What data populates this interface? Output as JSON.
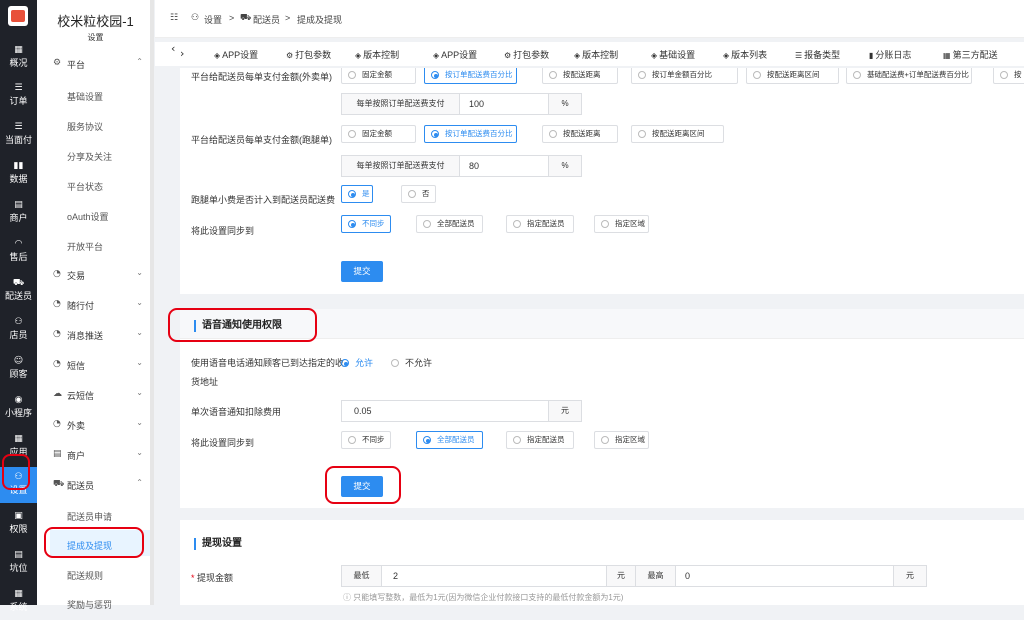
{
  "left_nav": [
    {
      "icon": "▦",
      "label": "概况"
    },
    {
      "icon": "☰",
      "label": "订单"
    },
    {
      "icon": "☰",
      "label": "当面付"
    },
    {
      "icon": "▮▮",
      "label": "数据"
    },
    {
      "icon": "▤",
      "label": "商户"
    },
    {
      "icon": "◠",
      "label": "售后"
    },
    {
      "icon": "⛟",
      "label": "配送员"
    },
    {
      "icon": "⚇",
      "label": "店员"
    },
    {
      "icon": "☺",
      "label": "顾客"
    },
    {
      "icon": "◉",
      "label": "小程序"
    },
    {
      "icon": "▦",
      "label": "应用"
    },
    {
      "icon": "⚇",
      "label": "设置"
    },
    {
      "icon": "▣",
      "label": "权限"
    },
    {
      "icon": "▤",
      "label": "坑位"
    },
    {
      "icon": "▦",
      "label": "系统"
    }
  ],
  "sidebar": {
    "school_name": "校米粒校园-1",
    "subtitle": "设置",
    "platform": {
      "icon": "⚙",
      "label": "平台",
      "arrow": "⌃"
    },
    "platform_items": [
      "基础设置",
      "服务协议",
      "分享及关注",
      "平台状态",
      "oAuth设置",
      "开放平台"
    ],
    "groups": [
      {
        "icon": "◔",
        "label": "交易",
        "arrow": "⌄"
      },
      {
        "icon": "◔",
        "label": "随行付",
        "arrow": "⌄"
      },
      {
        "icon": "◔",
        "label": "消息推送",
        "arrow": "⌄"
      },
      {
        "icon": "◔",
        "label": "短信",
        "arrow": "⌄"
      },
      {
        "icon": "☁",
        "label": "云短信",
        "arrow": "⌄"
      },
      {
        "icon": "◔",
        "label": "外卖",
        "arrow": "⌄"
      },
      {
        "icon": "▤",
        "label": "商户",
        "arrow": "⌄"
      },
      {
        "icon": "⛟",
        "label": "配送员",
        "arrow": "⌃"
      }
    ],
    "courier_items": [
      "配送员申请",
      "提成及提现",
      "配送规则",
      "奖励与惩罚"
    ]
  },
  "topbar": {
    "menu_icon": "☷",
    "crumb_icon": "⚇",
    "crumb1": "设置",
    "sep": ">",
    "crumb2_icon": "⛟",
    "crumb2": "配送员",
    "crumb3": "提成及提现"
  },
  "tabs": {
    "prev": "‹",
    "next": "›",
    "items": [
      {
        "icon": "◈",
        "label": "APP设置"
      },
      {
        "icon": "⚙",
        "label": "打包参数"
      },
      {
        "icon": "◈",
        "label": "版本控制"
      },
      {
        "icon": "◈",
        "label": "APP设置"
      },
      {
        "icon": "⚙",
        "label": "打包参数"
      },
      {
        "icon": "◈",
        "label": "版本控制"
      },
      {
        "icon": "◈",
        "label": "基础设置"
      },
      {
        "icon": "◈",
        "label": "版本列表"
      },
      {
        "icon": "☰",
        "label": "报备类型"
      },
      {
        "icon": "▮",
        "label": "分账日志"
      },
      {
        "icon": "▦",
        "label": "第三方配送"
      }
    ]
  },
  "pay_takeout": {
    "label": "平台给配送员每单支付金额(外卖单)",
    "options": [
      "固定金额",
      "按订单配送费百分比",
      "按配送距离",
      "按订单金额百分比",
      "按配送距离区间",
      "基础配送费+订单配送费百分比",
      "按"
    ],
    "input_prefix": "每单按照订单配送费支付",
    "input_value": "100",
    "input_suffix": "%"
  },
  "pay_errand": {
    "label": "平台给配送员每单支付金额(跑腿单)",
    "options": [
      "固定金额",
      "按订单配送费百分比",
      "按配送距离",
      "按配送距离区间"
    ],
    "input_prefix": "每单按照订单配送费支付",
    "input_value": "80",
    "input_suffix": "%"
  },
  "tip_included": {
    "label": "跑腿单小费是否计入到配送员配送费",
    "options": [
      "是",
      "否"
    ]
  },
  "sync1": {
    "label": "将此设置同步到",
    "options": [
      "不同步",
      "全部配送员",
      "指定配送员",
      "指定区域"
    ]
  },
  "submit1": "提交",
  "voice": {
    "title": "语音通知使用权限",
    "perm_label_1": "使用语音电话通知顾客已到达指定的收",
    "perm_label_2": "货地址",
    "perm_options": [
      "允许",
      "不允许"
    ],
    "fee_label": "单次语音通知扣除费用",
    "fee_value": "0.05",
    "fee_unit": "元",
    "sync_label": "将此设置同步到",
    "sync_options": [
      "不同步",
      "全部配送员",
      "指定配送员",
      "指定区域"
    ],
    "submit": "提交"
  },
  "withdraw": {
    "title": "提现设置",
    "amount_label": "提现金额",
    "req_mark": "*",
    "min_label": "最低",
    "min_value": "2",
    "unit1": "元",
    "max_label": "最高",
    "max_value": "0",
    "unit2": "元",
    "hint": "ⓘ 只能填写整数，最低为1元(因为微信企业付款接口支持的最低付款金额为1元)"
  }
}
